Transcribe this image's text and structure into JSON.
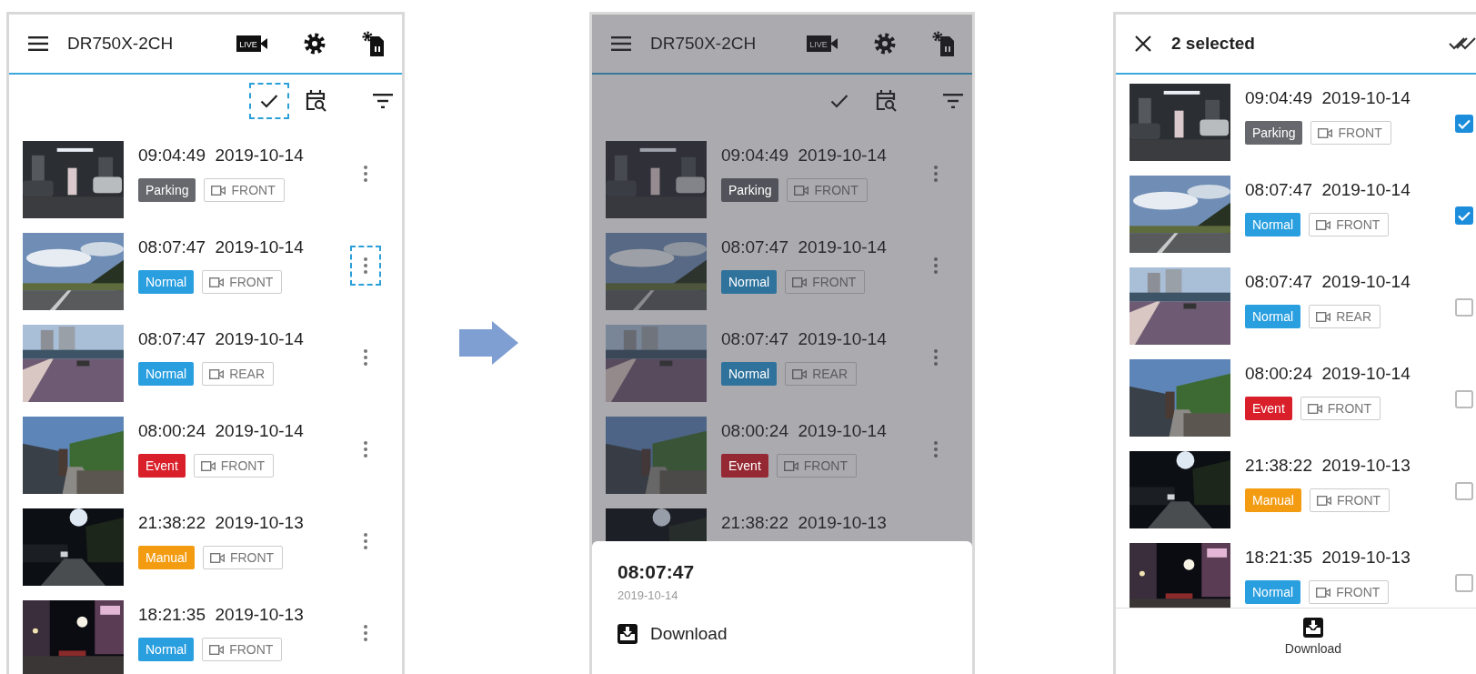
{
  "screens": [
    {
      "kind": "list",
      "dimmed": false,
      "header": {
        "title": "DR750X-2CH",
        "live_label": "LIVE"
      },
      "toolbar": {
        "check_highlighted": true
      },
      "rows": [
        {
          "time": "09:04:49",
          "date": "2019-10-14",
          "type": "Parking",
          "color": "#66686d",
          "camera": "FRONT",
          "menu_highlighted": false
        },
        {
          "time": "08:07:47",
          "date": "2019-10-14",
          "type": "Normal",
          "color": "#2a9fe0",
          "camera": "FRONT",
          "menu_highlighted": true
        },
        {
          "time": "08:07:47",
          "date": "2019-10-14",
          "type": "Normal",
          "color": "#2a9fe0",
          "camera": "REAR",
          "menu_highlighted": false
        },
        {
          "time": "08:00:24",
          "date": "2019-10-14",
          "type": "Event",
          "color": "#d91f2a",
          "camera": "FRONT",
          "menu_highlighted": false
        },
        {
          "time": "21:38:22",
          "date": "2019-10-13",
          "type": "Manual",
          "color": "#f39c12",
          "camera": "FRONT",
          "menu_highlighted": false
        },
        {
          "time": "18:21:35",
          "date": "2019-10-13",
          "type": "Normal",
          "color": "#2a9fe0",
          "camera": "FRONT",
          "menu_highlighted": false
        }
      ]
    },
    {
      "kind": "list",
      "dimmed": true,
      "header": {
        "title": "DR750X-2CH",
        "live_label": "LIVE"
      },
      "toolbar": {
        "check_highlighted": false
      },
      "rows": [
        {
          "time": "09:04:49",
          "date": "2019-10-14",
          "type": "Parking",
          "color": "#52535a",
          "camera": "FRONT",
          "menu_highlighted": false
        },
        {
          "time": "08:07:47",
          "date": "2019-10-14",
          "type": "Normal",
          "color": "#2f739d",
          "camera": "FRONT",
          "menu_highlighted": false
        },
        {
          "time": "08:07:47",
          "date": "2019-10-14",
          "type": "Normal",
          "color": "#2f739d",
          "camera": "REAR",
          "menu_highlighted": false
        },
        {
          "time": "08:00:24",
          "date": "2019-10-14",
          "type": "Event",
          "color": "#952933",
          "camera": "FRONT",
          "menu_highlighted": false
        },
        {
          "time": "21:38:22",
          "date": "2019-10-13"
        }
      ],
      "sheet": {
        "time": "08:07:47",
        "date": "2019-10-14",
        "action": "Download"
      }
    },
    {
      "kind": "select",
      "header": {
        "title": "2 selected"
      },
      "rows": [
        {
          "time": "09:04:49",
          "date": "2019-10-14",
          "type": "Parking",
          "color": "#66686d",
          "camera": "FRONT",
          "checked": true
        },
        {
          "time": "08:07:47",
          "date": "2019-10-14",
          "type": "Normal",
          "color": "#2a9fe0",
          "camera": "FRONT",
          "checked": true
        },
        {
          "time": "08:07:47",
          "date": "2019-10-14",
          "type": "Normal",
          "color": "#2a9fe0",
          "camera": "REAR",
          "checked": false
        },
        {
          "time": "08:00:24",
          "date": "2019-10-14",
          "type": "Event",
          "color": "#d91f2a",
          "camera": "FRONT",
          "checked": false
        },
        {
          "time": "21:38:22",
          "date": "2019-10-13",
          "type": "Manual",
          "color": "#f39c12",
          "camera": "FRONT",
          "checked": false
        },
        {
          "time": "18:21:35",
          "date": "2019-10-13",
          "type": "Normal",
          "color": "#2a9fe0",
          "camera": "FRONT",
          "checked": false
        }
      ],
      "bottom_action": "Download"
    }
  ]
}
